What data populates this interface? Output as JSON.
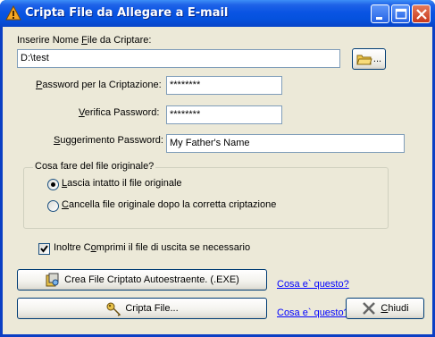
{
  "window": {
    "title": "Cripta File da Allegare a E-mail"
  },
  "file": {
    "label_before": "Inserire Nome ",
    "label_underlined": "F",
    "label_after": "ile da Criptare:",
    "value": "D:\\test",
    "browse_label": "..."
  },
  "password": {
    "label_underlined": "P",
    "label_after": "assword per la Criptazione:",
    "value": "********"
  },
  "verify": {
    "label_underlined": "V",
    "label_after": "erifica Password:",
    "value": "********"
  },
  "hint": {
    "label_underlined": "S",
    "label_after": "uggerimento Password:",
    "value": "My Father's Name"
  },
  "original": {
    "group_label": "Cosa fare del file originale?",
    "options": [
      {
        "underlined": "L",
        "rest": "ascia intatto il file originale",
        "selected": true
      },
      {
        "underlined": "C",
        "rest": "ancella file originale dopo la corretta criptazione",
        "selected": false
      }
    ]
  },
  "compress": {
    "label_before": "Inoltre C",
    "label_underlined": "o",
    "label_after": "mprimi il file di uscita se necessario",
    "checked": true
  },
  "buttons": {
    "exe": "Crea File Criptato Autoestraente. (.EXE)",
    "encrypt": "Cripta File...",
    "close_underlined": "C",
    "close_rest": "hiudi",
    "help_link_1": "Cosa e` questo?",
    "help_link_2": "Cosa e` questo?"
  }
}
